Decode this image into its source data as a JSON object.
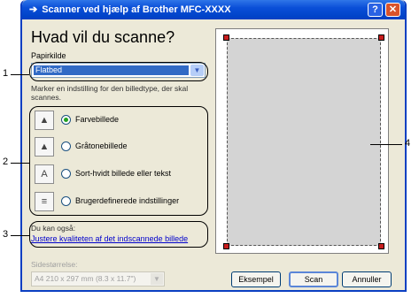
{
  "window": {
    "title": "Scanner ved hjælp af Brother  MFC-XXXX",
    "help_label": "?",
    "close_label": "✕"
  },
  "main": {
    "heading": "Hvad vil du scanne?",
    "source_label": "Papirkilde",
    "source_value": "Flatbed",
    "description": "Marker en indstilling for den billedtype, der skal scannes.",
    "options": [
      {
        "label": "Farvebillede",
        "icon": "color-picture-icon",
        "selected": true
      },
      {
        "label": "Gråtonebillede",
        "icon": "grayscale-picture-icon",
        "selected": false
      },
      {
        "label": "Sort-hvidt billede eller tekst",
        "icon": "black-white-text-icon",
        "selected": false
      },
      {
        "label": "Brugerdefinerede indstillinger",
        "icon": "custom-settings-icon",
        "selected": false
      }
    ],
    "also_label": "Du kan også:",
    "adjust_link": "Justere kvaliteten af det indscannede billede",
    "page_size_label": "Sidestørrelse:",
    "page_size_value": "A4 210 x 297 mm (8.3 x 11.7\")"
  },
  "buttons": {
    "preview": "Eksempel",
    "scan": "Scan",
    "cancel": "Annuller"
  },
  "callouts": [
    "1",
    "2",
    "3",
    "4"
  ],
  "colors": {
    "titlebar": "#0a4fd8",
    "selection": "#316ac5",
    "link": "#0000cc",
    "corner_marker": "#c81e1e",
    "scan_area": "#d4d4d4"
  }
}
